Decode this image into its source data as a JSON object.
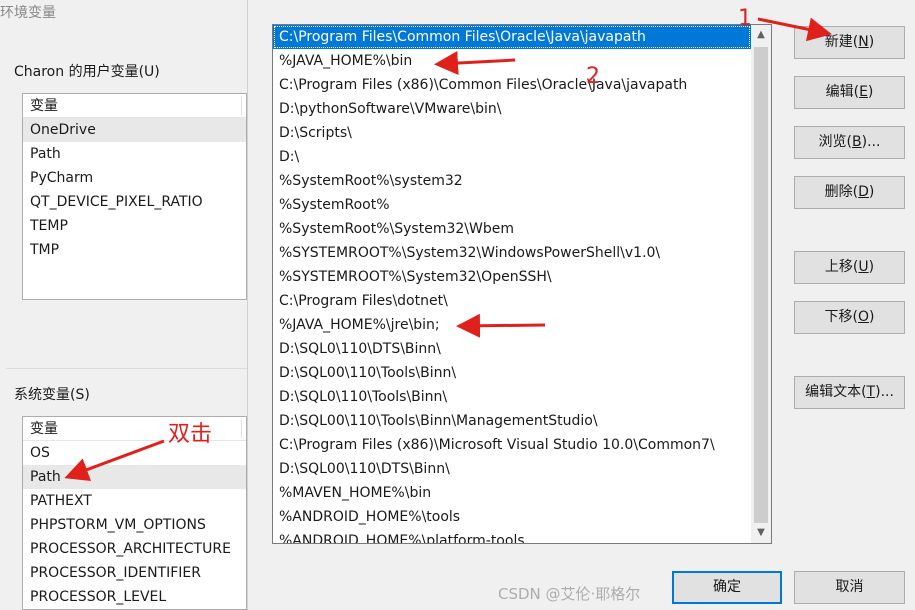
{
  "back_dialog": {
    "title": "环境变量",
    "user_vars": {
      "label": "Charon 的用户变量(U)",
      "header": "变量",
      "items": [
        "OneDrive",
        "Path",
        "PyCharm",
        "QT_DEVICE_PIXEL_RATIO",
        "TEMP",
        "TMP"
      ]
    },
    "system_vars": {
      "label": "系统变量(S)",
      "header": "变量",
      "items": [
        "OS",
        "Path",
        "PATHEXT",
        "PHPSTORM_VM_OPTIONS",
        "PROCESSOR_ARCHITECTURE",
        "PROCESSOR_IDENTIFIER",
        "PROCESSOR_LEVEL"
      ]
    }
  },
  "edit_dialog": {
    "paths": [
      "C:\\Program Files\\Common Files\\Oracle\\Java\\javapath",
      "%JAVA_HOME%\\bin",
      "C:\\Program Files (x86)\\Common Files\\Oracle\\Java\\javapath",
      "D:\\pythonSoftware\\VMware\\bin\\",
      "D:\\Scripts\\",
      "D:\\",
      "%SystemRoot%\\system32",
      "%SystemRoot%",
      "%SystemRoot%\\System32\\Wbem",
      "%SYSTEMROOT%\\System32\\WindowsPowerShell\\v1.0\\",
      "%SYSTEMROOT%\\System32\\OpenSSH\\",
      "C:\\Program Files\\dotnet\\",
      "%JAVA_HOME%\\jre\\bin;",
      "D:\\SQL0\\110\\DTS\\Binn\\",
      "D:\\SQL00\\110\\Tools\\Binn\\",
      "D:\\SQL0\\110\\Tools\\Binn\\",
      "D:\\SQL00\\110\\Tools\\Binn\\ManagementStudio\\",
      "C:\\Program Files (x86)\\Microsoft Visual Studio 10.0\\Common7\\",
      "D:\\SQL00\\110\\DTS\\Binn\\",
      "%MAVEN_HOME%\\bin",
      "%ANDROID_HOME%\\tools",
      "%ANDROID_HOME%\\platform-tools"
    ],
    "buttons": {
      "new": {
        "text": "新建(",
        "key": "N",
        "end": ")"
      },
      "edit": {
        "text": "编辑(",
        "key": "E",
        "end": ")"
      },
      "browse": {
        "text": "浏览(",
        "key": "B",
        "end": ")..."
      },
      "delete": {
        "text": "删除(",
        "key": "D",
        "end": ")"
      },
      "move_up": {
        "text": "上移(",
        "key": "U",
        "end": ")"
      },
      "move_down": {
        "text": "下移(",
        "key": "O",
        "end": ")"
      },
      "edit_text": {
        "text": "编辑文本(",
        "key": "T",
        "end": ")..."
      }
    },
    "ok": "确定",
    "cancel": "取消"
  },
  "annotations": {
    "label_1": "1",
    "label_2": "2",
    "double_click": "双击",
    "color": "#e0201b"
  },
  "watermark": "CSDN @艾伦·耶格尔",
  "colors": {
    "selection": "#0078d7",
    "annotation": "#e0201b"
  }
}
